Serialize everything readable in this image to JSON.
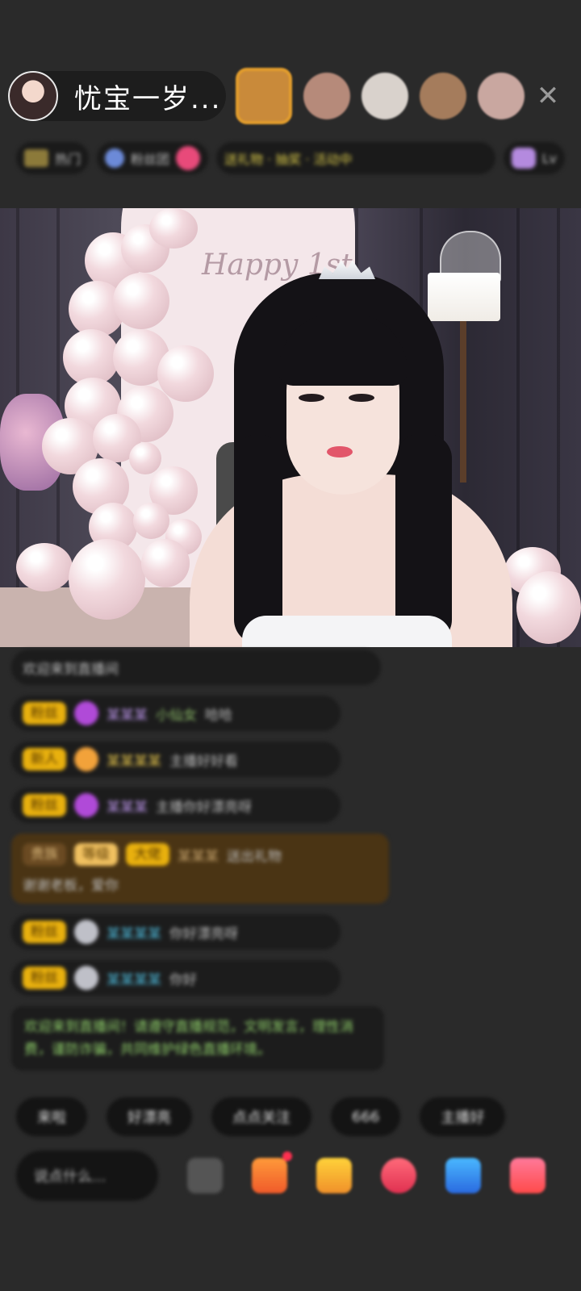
{
  "header": {
    "host_name": "忧宝一岁...",
    "viewers": [
      {
        "color": "#c98a3a",
        "ring": "#e29d2d"
      },
      {
        "color": "#b68a7a",
        "ring": "none"
      },
      {
        "color": "#d9d2cc",
        "ring": "none"
      },
      {
        "color": "#a57c5c",
        "ring": "none"
      },
      {
        "color": "#c9a7a0",
        "ring": "none"
      }
    ],
    "close_label": "✕"
  },
  "info_strip": {
    "rank_label": "热门",
    "fans_label": "粉丝团",
    "promo_text": "送礼物 · 抽奖 · 活动中",
    "level_label": "Lv"
  },
  "stream": {
    "backdrop_text": "Happy 1st"
  },
  "chat": {
    "notice": "欢迎来到直播间",
    "messages": [
      {
        "badge": "粉丝",
        "gem": "purple",
        "name": "某某某",
        "extra": "小仙女",
        "text": "哈哈"
      },
      {
        "badge": "新人",
        "gem": "orange",
        "name": "某某某某",
        "extra": "",
        "text": "主播好好看"
      },
      {
        "badge": "粉丝",
        "gem": "purple",
        "name": "某某某",
        "extra": "",
        "text": "主播你好漂亮呀"
      }
    ],
    "gold_message": {
      "tag1": "贵族",
      "tag2": "等级",
      "tag3": "大佬",
      "name": "某某某",
      "text": "送出礼物",
      "text2": "谢谢老板，爱你"
    },
    "messages2": [
      {
        "badge": "粉丝",
        "gem": "grey",
        "name": "某某某某",
        "extra": "",
        "text": "你好漂亮呀"
      },
      {
        "badge": "粉丝",
        "gem": "grey",
        "name": "某某某某",
        "extra": "",
        "text": "你好"
      }
    ],
    "system_message": "欢迎来到直播间！请遵守直播规范，文明发言，理性消费，谨防诈骗，共同维护绿色直播环境。"
  },
  "quick_replies": [
    "来啦",
    "好漂亮",
    "点点关注",
    "666",
    "主播好"
  ],
  "bottom_bar": {
    "input_placeholder": "说点什么..."
  }
}
